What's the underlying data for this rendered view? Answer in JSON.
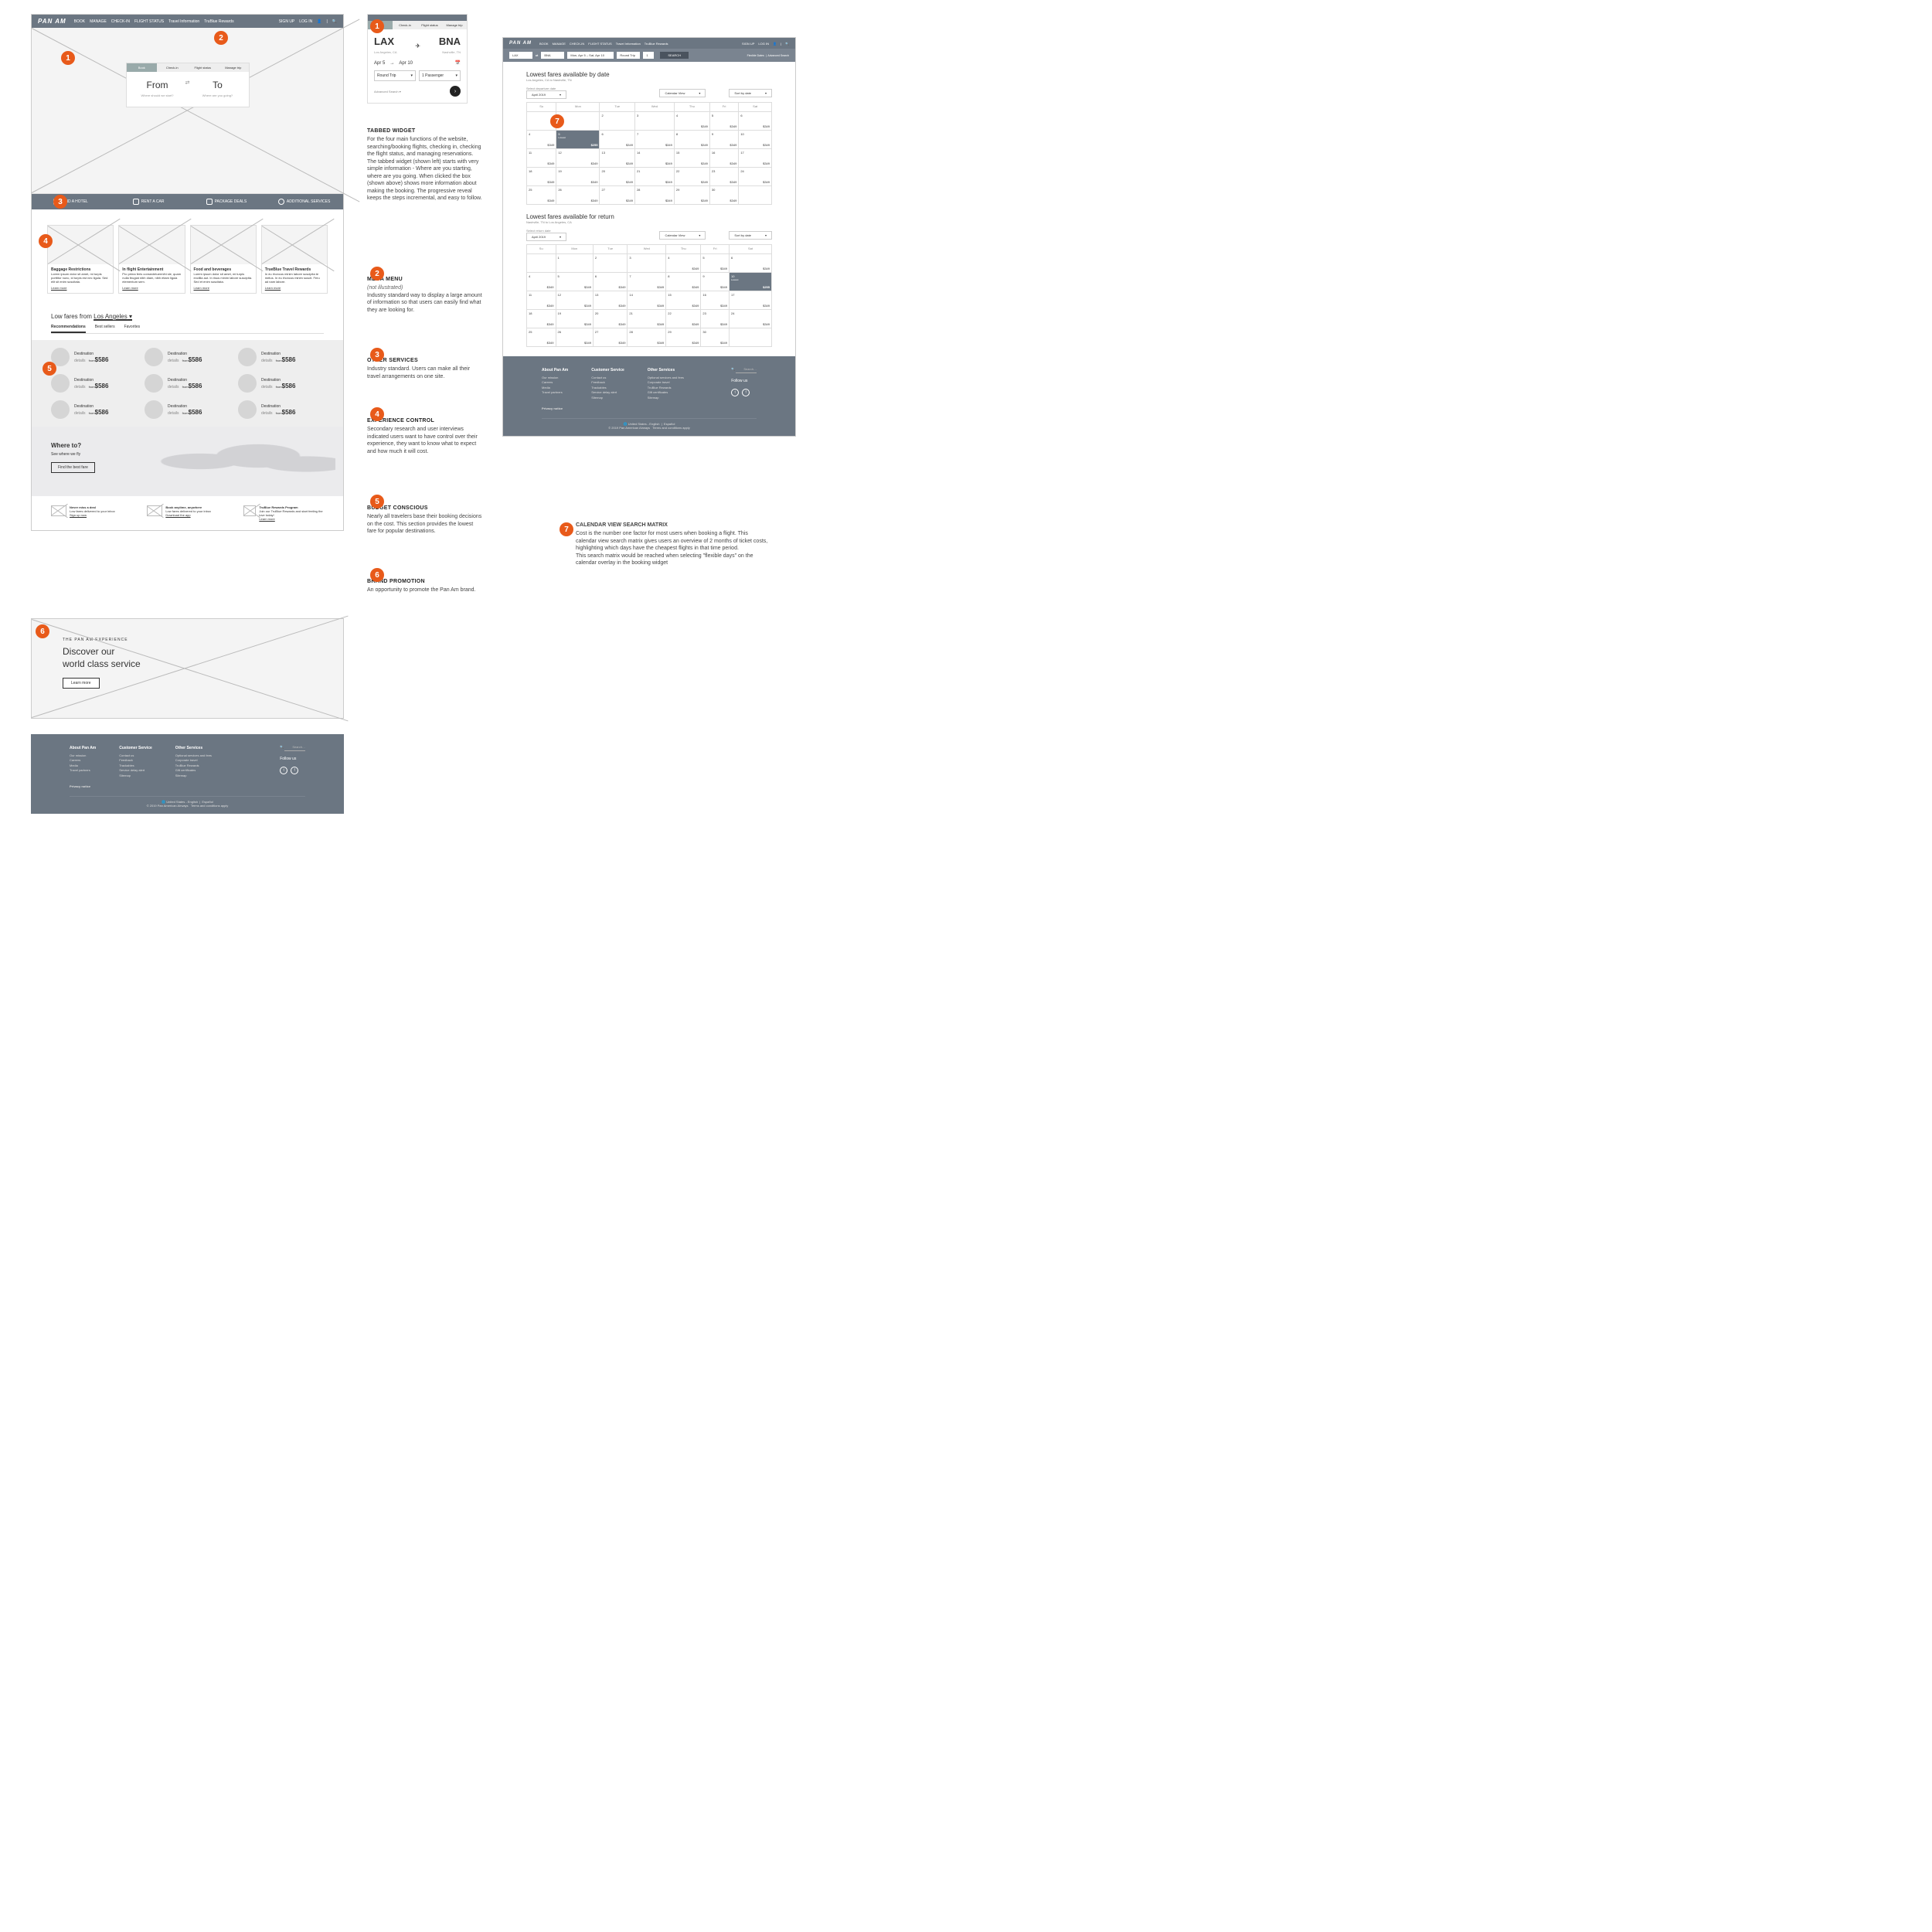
{
  "nav": {
    "logo": "PAN AM",
    "links": [
      "BOOK",
      "MANAGE",
      "CHECK-IN",
      "FLIGHT STATUS",
      "Travel Information",
      "TruBlue Rewards"
    ],
    "right": [
      "SIGN UP",
      "LOG IN"
    ],
    "person_glyph": "👤",
    "sep": "|",
    "search_glyph": "🔍"
  },
  "booking_tabs": [
    "Book",
    "Check-in",
    "Flight status",
    "Manage trip"
  ],
  "from_to": {
    "from": "From",
    "from_hint": "Where should we start?",
    "swap": "⇄",
    "to": "To",
    "to_hint": "Where are you going?"
  },
  "other_services": [
    "FIND A HOTEL",
    "RENT A CAR",
    "PACKAGE DEALS",
    "ADDITIONAL SERVICES"
  ],
  "exp_cards": [
    {
      "title": "Baggage Restrictions",
      "body": "Lorem ipsum dolor sit amet, mi turpis porttitor nunc, id turpis est nec ligula. Sed elit sit enim suscitata.",
      "lm": "Learn more"
    },
    {
      "title": "In flight Entertainment",
      "body": "Pro prima feris consectetuermihi sle, quam nulla feugiat nibh diam, nibh etiam ligula elementum sem.",
      "lm": "Learn more"
    },
    {
      "title": "Food and beverages",
      "body": "Lorem ipsum dolor sit amet, mi turpis excillia aut. In risus minim labore suscipita. Sed et enim suscitata.",
      "lm": "Learn more"
    },
    {
      "title": "TrueBlue Travel Rewards",
      "body": "In eu rhoncus minim labore suscipita te metus. In eu rhoncus minim suscit. Feru ad nam labore.",
      "lm": "Learn more"
    }
  ],
  "lowfares": {
    "title_a": "Low fares from ",
    "title_city": "Los Angeles",
    "chev": "▾",
    "tabs": [
      "Recommendations",
      "Best sellers",
      "Favorites"
    ],
    "items": [
      {
        "dest": "Destination",
        "det": "details",
        "from": "from",
        "price": "$586"
      },
      {
        "dest": "Destination",
        "det": "details",
        "from": "from",
        "price": "$586"
      },
      {
        "dest": "Destination",
        "det": "details",
        "from": "from",
        "price": "$586"
      },
      {
        "dest": "Destination",
        "det": "details",
        "from": "from",
        "price": "$586"
      },
      {
        "dest": "Destination",
        "det": "details",
        "from": "from",
        "price": "$586"
      },
      {
        "dest": "Destination",
        "det": "details",
        "from": "from",
        "price": "$586"
      },
      {
        "dest": "Destination",
        "det": "details",
        "from": "from",
        "price": "$586"
      },
      {
        "dest": "Destination",
        "det": "details",
        "from": "from",
        "price": "$586"
      },
      {
        "dest": "Destination",
        "det": "details",
        "from": "from",
        "price": "$586"
      }
    ]
  },
  "whereto": {
    "h": "Where to?",
    "s": "See where we fly",
    "btn": "Find the best fare"
  },
  "promos": [
    {
      "h": "Never miss a deal",
      "s": "Low fares delivered to your inbox",
      "a": "Sign up now"
    },
    {
      "h": "Book anytime, anywhere",
      "s": "Low fares delivered to your inbox",
      "a": "Download the app"
    },
    {
      "h": "TruBlue Rewards Program",
      "s": "Join our TruBlue Rewards and start feeling the love today!",
      "a": "Learn more"
    }
  ],
  "brand": {
    "kicker": "THE PAN AM EXPERIENCE",
    "h": "Discover our\nworld class service",
    "btn": "Learn more"
  },
  "footer": {
    "cols": [
      {
        "h": "About Pan Am",
        "items": [
          "Our mission",
          "Careers",
          "Media",
          "Travel partners"
        ]
      },
      {
        "h": "Customer Service",
        "items": [
          "Contact us",
          "Feedback",
          "Trackables",
          "Service delay alert",
          "Sitemap"
        ]
      },
      {
        "h": "Other Services",
        "items": [
          "Optional services and fees",
          "Corporate travel",
          "TruBlue Rewards",
          "Gift certificates",
          "Sitemap"
        ]
      }
    ],
    "privacy": "Privacy notice",
    "search": "Search…",
    "follow": "Follow us",
    "tw": "t",
    "fb": "f",
    "locale": "United States - English",
    "sep": "|",
    "es": "Español",
    "copy": "© 2019 Pan American Airways",
    "terms": "Terms and conditions apply"
  },
  "widget": {
    "from_code": "LAX",
    "from_city": "Los Angeles, CA",
    "plane": "✈",
    "to_code": "BNA",
    "to_city": "Nashville, TN",
    "date_from": "Apr 5",
    "dash": "→",
    "date_to": "Apr 10",
    "cal": "📅",
    "trip": "Round Trip",
    "pax": "1 Passenger",
    "chev": "▾",
    "adv": "Advanced Search ▾",
    "go": "›"
  },
  "anno": {
    "a1": {
      "h": "TABBED WIDGET",
      "b": "For the four main functions of the website, searching/booking flights, checking in, checking the flight status, and managing reservations. The tabbed widget (shown left) starts with very simple information - Where are you starting, where are you going. When clicked the box (shown above) shows more information about making the booking. The progressive reveal keeps the steps incremental, and easy to follow."
    },
    "a2": {
      "h": "MEGA MENU",
      "i": "(not illustrated)",
      "b": "Industry standard way to display a large amount of information so that users can easily find what they are looking for."
    },
    "a3": {
      "h": "OTHER SERVICES",
      "b": "Industry standard. Users can make all their travel arrangements on one site."
    },
    "a4": {
      "h": "EXPERIENCE CONTROL",
      "b": "Secondary research and user interviews indicated users want to have control over their experience, they want to know what to expect and how much it will cost."
    },
    "a5": {
      "h": "BUDGET CONSCIOUS",
      "b": "Nearly all travelers base their booking decisions on the cost. This section provides the lowest fare for popular destinations."
    },
    "a6": {
      "h": "BRAND PROMOTION",
      "b": "An opportunity to promote the Pan Am brand."
    },
    "a7": {
      "h": "CALENDAR VIEW SEARCH MATRIX",
      "b": "Cost is the number one factor for most users when booking a flight. This calendar view search matrix gives users an overview of 2 months of ticket costs, highlighting which days have the cheapest flights in that time period.\nThis search matrix would be reached when selecting \"flexible days\" on the calendar overlay in the booking widget"
    }
  },
  "cal": {
    "searchbar": {
      "from": "LAX",
      "to": "BNA",
      "dates": "Mon, Apr 5 – Sat, Apr 10",
      "trip": "Round Trip",
      "pax": "1",
      "btn": "SEARCH",
      "links": [
        "Flexible Dates",
        "Advanced Search"
      ]
    },
    "h_dep": "Lowest fares available by date",
    "sub_dep": "Los Angeles, CA to Nashville, TN",
    "h_ret": "Lowest fares available for return",
    "sub_ret": "Nashville, TN to Los Angeles, CA",
    "ctrl_label": "Select departure date",
    "ctrl_label_ret": "Select return date",
    "month": "April 2019",
    "view": "Calendar View",
    "sort": "Sort by date",
    "days": [
      "Su",
      "Mon",
      "Tue",
      "Wed",
      "Thu",
      "Fri",
      "Sat"
    ],
    "lowest_label": "Lowest",
    "dep": {
      "sel_day": "5",
      "sel_price": "$255",
      "rows": [
        [
          {
            "d": ""
          },
          {
            "d": "1"
          },
          {
            "d": "2"
          },
          {
            "d": "3"
          },
          {
            "d": "4",
            "p": "$349"
          },
          {
            "d": "5",
            "p": "$349"
          },
          {
            "d": "6",
            "p": "$349"
          }
        ],
        [
          {
            "d": "4",
            "p": "$349"
          },
          {
            "d": "5",
            "sel": true
          },
          {
            "d": "6",
            "p": "$349"
          },
          {
            "d": "7",
            "p": "$349"
          },
          {
            "d": "8",
            "p": "$349"
          },
          {
            "d": "9",
            "p": "$349"
          },
          {
            "d": "10",
            "p": "$349"
          }
        ],
        [
          {
            "d": "11",
            "p": "$349"
          },
          {
            "d": "12",
            "p": "$349"
          },
          {
            "d": "13",
            "p": "$349"
          },
          {
            "d": "14",
            "p": "$349"
          },
          {
            "d": "15",
            "p": "$349"
          },
          {
            "d": "16",
            "p": "$349"
          },
          {
            "d": "17",
            "p": "$349"
          }
        ],
        [
          {
            "d": "18",
            "p": "$349"
          },
          {
            "d": "19",
            "p": "$349"
          },
          {
            "d": "20",
            "p": "$349"
          },
          {
            "d": "21",
            "p": "$349"
          },
          {
            "d": "22",
            "p": "$349"
          },
          {
            "d": "23",
            "p": "$349"
          },
          {
            "d": "24",
            "p": "$349"
          }
        ],
        [
          {
            "d": "25",
            "p": "$349"
          },
          {
            "d": "26",
            "p": "$349"
          },
          {
            "d": "27",
            "p": "$349"
          },
          {
            "d": "28",
            "p": "$349"
          },
          {
            "d": "29",
            "p": "$349"
          },
          {
            "d": "30",
            "p": "$349"
          },
          {
            "d": ""
          }
        ]
      ]
    },
    "ret": {
      "sel_day": "10",
      "sel_price": "$255",
      "rows": [
        [
          {
            "d": ""
          },
          {
            "d": "1"
          },
          {
            "d": "2"
          },
          {
            "d": "3"
          },
          {
            "d": "4",
            "p": "$349"
          },
          {
            "d": "5",
            "p": "$349"
          },
          {
            "d": "6",
            "p": "$349"
          }
        ],
        [
          {
            "d": "4",
            "p": "$349"
          },
          {
            "d": "5",
            "p": "$349"
          },
          {
            "d": "6",
            "p": "$349"
          },
          {
            "d": "7",
            "p": "$349"
          },
          {
            "d": "8",
            "p": "$349"
          },
          {
            "d": "9",
            "p": "$349"
          },
          {
            "d": "10",
            "sel": true
          }
        ],
        [
          {
            "d": "11",
            "p": "$349"
          },
          {
            "d": "12",
            "p": "$349"
          },
          {
            "d": "13",
            "p": "$349"
          },
          {
            "d": "14",
            "p": "$349"
          },
          {
            "d": "15",
            "p": "$349"
          },
          {
            "d": "16",
            "p": "$349"
          },
          {
            "d": "17",
            "p": "$349"
          }
        ],
        [
          {
            "d": "18",
            "p": "$349"
          },
          {
            "d": "19",
            "p": "$349"
          },
          {
            "d": "20",
            "p": "$349"
          },
          {
            "d": "21",
            "p": "$349"
          },
          {
            "d": "22",
            "p": "$349"
          },
          {
            "d": "23",
            "p": "$349"
          },
          {
            "d": "24",
            "p": "$349"
          }
        ],
        [
          {
            "d": "25",
            "p": "$349"
          },
          {
            "d": "26",
            "p": "$349"
          },
          {
            "d": "27",
            "p": "$349"
          },
          {
            "d": "28",
            "p": "$349"
          },
          {
            "d": "29",
            "p": "$349"
          },
          {
            "d": "30",
            "p": "$349"
          },
          {
            "d": ""
          }
        ]
      ]
    }
  },
  "globe": "🌐"
}
